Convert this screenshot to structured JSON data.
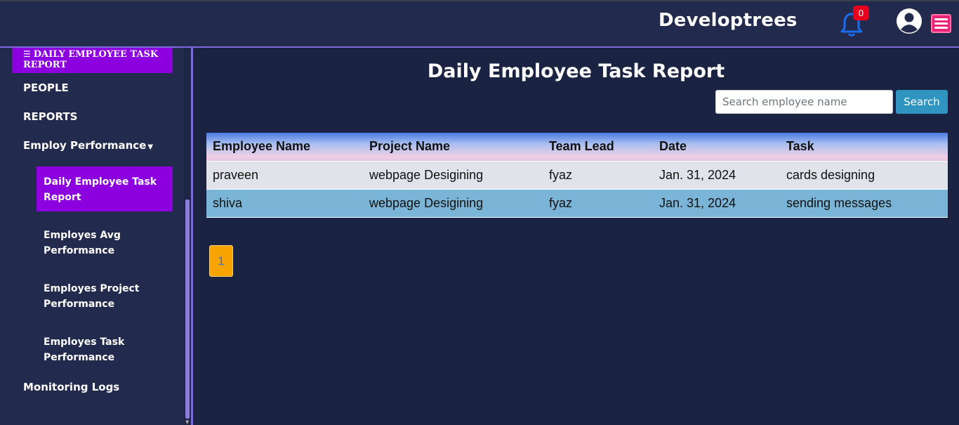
{
  "header": {
    "brand": "Developtrees",
    "notification_count": "0"
  },
  "sidebar": {
    "header_item": "DAILY EMPLOYEE TASK REPORT",
    "items": [
      {
        "label": "PEOPLE"
      },
      {
        "label": "REPORTS"
      },
      {
        "label": "Employ Performance"
      }
    ],
    "sub_items": [
      {
        "label": "Daily Employee Task Report",
        "active": true
      },
      {
        "label": "Employes Avg Performance"
      },
      {
        "label": "Employes Project Performance"
      },
      {
        "label": "Employes Task Performance"
      }
    ],
    "bottom_item": "Monitoring Logs"
  },
  "main": {
    "title": "Daily Employee Task Report",
    "search": {
      "placeholder": "Search employee name",
      "value": "",
      "button": "Search"
    },
    "table": {
      "columns": [
        "Employee Name",
        "Project Name",
        "Team Lead",
        "Date",
        "Task"
      ],
      "rows": [
        [
          "praveen",
          "webpage Desigining",
          "fyaz",
          "Jan. 31, 2024",
          "cards designing"
        ],
        [
          "shiva",
          "webpage Desigining",
          "fyaz",
          "Jan. 31, 2024",
          "sending messages"
        ]
      ]
    },
    "pagination": {
      "current": "1"
    }
  },
  "colors": {
    "background": "#1b2343",
    "active_nav": "#8c00e0",
    "search_button": "#2f95c0",
    "pager": "#f7a400",
    "badge": "#e8001c"
  },
  "icons": [
    "bell-icon",
    "user-circle-icon",
    "hamburger-menu-icon",
    "list-check-icon",
    "caret-down-icon"
  ]
}
